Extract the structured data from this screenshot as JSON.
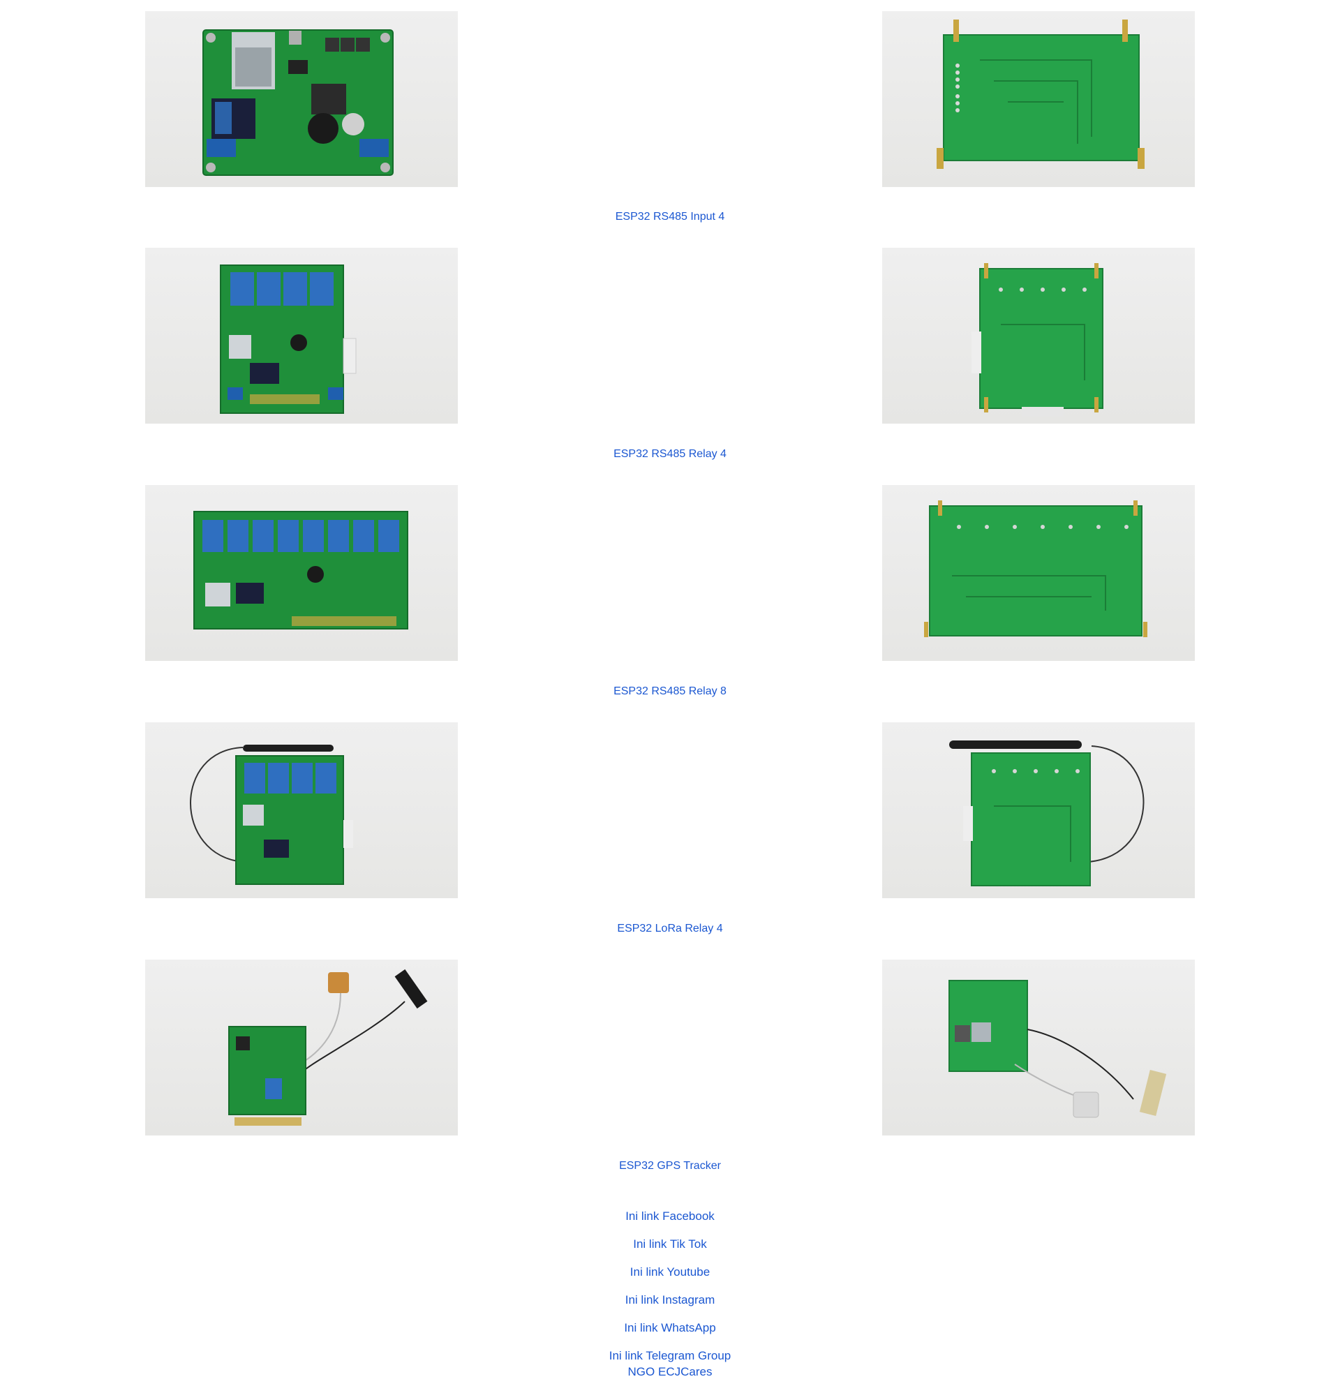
{
  "products": [
    {
      "name": "ESP32 RS485 Input 4",
      "front_photo": "pcb-front-photo",
      "back_photo": "pcb-back-photo"
    },
    {
      "name": "ESP32 RS485 Relay 4",
      "front_photo": "pcb-front-photo",
      "back_photo": "pcb-back-photo"
    },
    {
      "name": "ESP32 RS485 Relay 8",
      "front_photo": "pcb-front-photo",
      "back_photo": "pcb-back-photo"
    },
    {
      "name": "ESP32 LoRa Relay 4",
      "front_photo": "pcb-front-photo",
      "back_photo": "pcb-back-photo"
    },
    {
      "name": "ESP32 GPS Tracker",
      "front_photo": "pcb-front-photo",
      "back_photo": "pcb-back-photo"
    }
  ],
  "social_links": [
    "Ini link Facebook",
    "Ini link Tik Tok",
    "Ini link Youtube",
    "Ini link Instagram",
    "Ini link WhatsApp",
    "Ini link Telegram Group"
  ],
  "footer": {
    "org_link": "NGO ECJCares"
  },
  "colors": {
    "link": "#1b57d1",
    "pcb_green": "#1f8f3a",
    "relay_blue": "#2f6fc0",
    "background": "#ffffff"
  }
}
